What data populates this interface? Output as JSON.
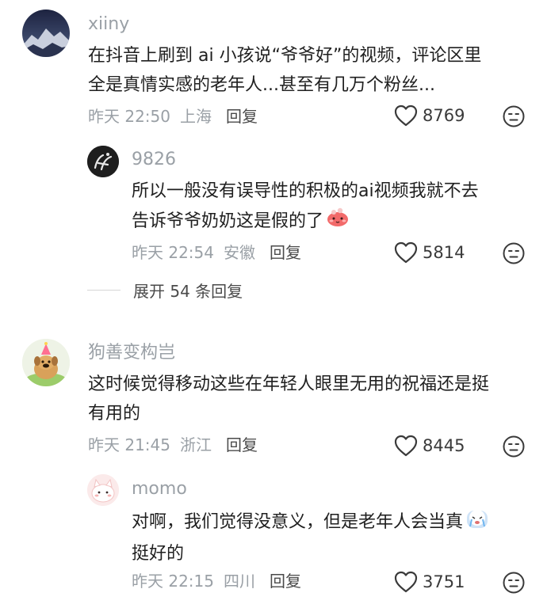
{
  "comments": [
    {
      "username": "xiiny",
      "lines": [
        "在抖音上刷到 ai 小孩说“爷爷好”的视频，评论区里",
        "全是真情实感的老年人...甚至有几万个粉丝..."
      ],
      "time": "昨天 22:50",
      "location": "上海",
      "reply_label": "回复",
      "likes": "8769",
      "avatar_icon": "mountain-night-avatar"
    },
    {
      "username": "9826",
      "lines": [
        "所以一般没有误导性的积极的ai视频我就不去",
        "告诉爷爷奶奶这是假的了"
      ],
      "time": "昨天 22:54",
      "location": "安徽",
      "reply_label": "回复",
      "likes": "5814",
      "avatar_icon": "dark-sketch-avatar",
      "emoji_icon": "blush-emoji-icon"
    },
    {
      "username": "狗善变构岂",
      "lines": [
        "这时候觉得移动这些在年轻人眼里无用的祝福还是挺",
        "有用的"
      ],
      "time": "昨天 21:45",
      "location": "浙江",
      "reply_label": "回复",
      "likes": "8445",
      "avatar_icon": "party-dog-avatar"
    },
    {
      "username": "momo",
      "lines": [
        "对啊，我们觉得没意义，但是老年人会当真",
        "挺好的"
      ],
      "time": "昨天 22:15",
      "location": "四川",
      "reply_label": "回复",
      "likes": "3751",
      "avatar_icon": "pink-cat-avatar",
      "emoji_icon": "crying-emoji-icon"
    }
  ],
  "expand_replies": "展开 54 条回复",
  "colors": {
    "meta": "#9aa0a6",
    "text": "#1f1f1f",
    "icon": "#3a3a3a"
  }
}
